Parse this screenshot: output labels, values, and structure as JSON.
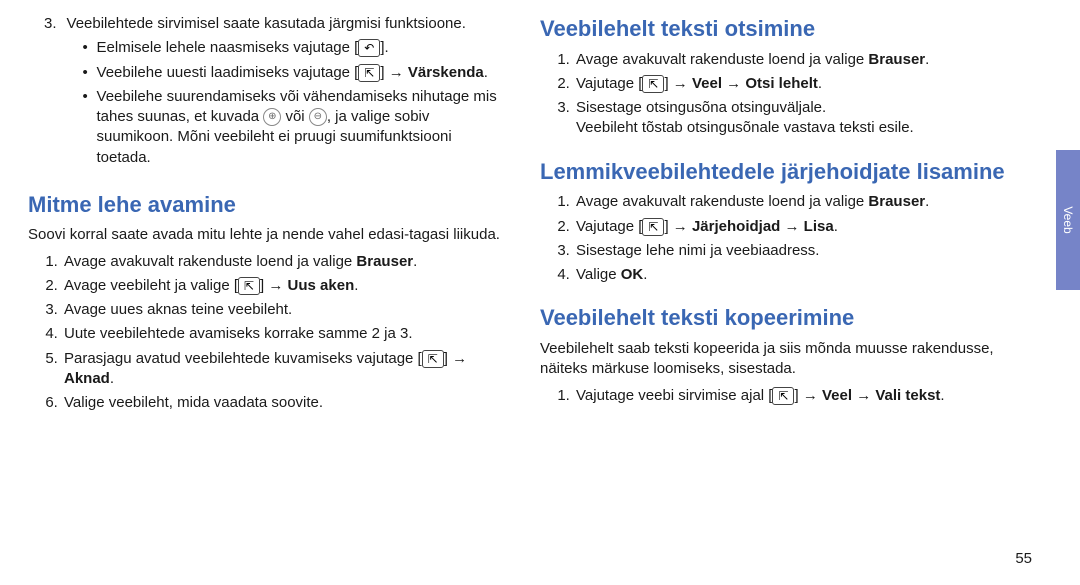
{
  "sideTab": "Veeb",
  "pageNumber": "55",
  "left": {
    "step3_intro": "Veebilehtede sirvimisel saate kasutada järgmisi funktsioone.",
    "step3_number": "3.",
    "b1_a": "Eelmisele lehele naasmiseks vajutage [",
    "b1_b": "].",
    "b2_a": "Veebilehe uuesti laadimiseks vajutage [",
    "b2_b": "] → ",
    "b2_strong": "Värskenda",
    "b2_c": ".",
    "b3_a": "Veebilehe suurendamiseks või vähendamiseks nihutage mis tahes suunas, et kuvada ",
    "b3_b": " või ",
    "b3_c": ", ja valige sobiv suumikoon. Mõni veebileht ei pruugi suumifunktsiooni toetada.",
    "h1": "Mitme lehe avamine",
    "p1": "Soovi korral saate avada mitu lehte ja nende vahel edasi-tagasi liikuda.",
    "s1_a": "Avage avakuvalt rakenduste loend ja valige ",
    "s1_strong": "Brauser",
    "s1_b": ".",
    "s2_a": "Avage veebileht ja valige [",
    "s2_b": "] → ",
    "s2_strong": "Uus aken",
    "s2_c": ".",
    "s3": "Avage uues aknas teine veebileht.",
    "s4": "Uute veebilehtede avamiseks korrake samme 2 ja 3.",
    "s5_a": "Parasjagu avatud veebilehtede kuvamiseks vajutage [",
    "s5_b": "] → ",
    "s5_strong": "Aknad",
    "s5_c": ".",
    "s6": "Valige veebileht, mida vaadata soovite."
  },
  "right": {
    "h2": "Veebilehelt teksti otsimine",
    "r1_a": "Avage avakuvalt rakenduste loend ja valige ",
    "r1_strong": "Brauser",
    "r1_b": ".",
    "r2_a": "Vajutage [",
    "r2_b": "] → ",
    "r2_strong1": "Veel",
    "r2_arrow": " → ",
    "r2_strong2": "Otsi lehelt",
    "r2_c": ".",
    "r3": "Sisestage otsingusõna otsinguväljale.",
    "r3b": "Veebileht tõstab otsingusõnale vastava teksti esile.",
    "h3": "Lemmikveebilehtedele järjehoidjate lisamine",
    "f1_a": "Avage avakuvalt rakenduste loend ja valige ",
    "f1_strong": "Brauser",
    "f1_b": ".",
    "f2_a": "Vajutage [",
    "f2_b": "] → ",
    "f2_strong1": "Järjehoidjad",
    "f2_arrow": " → ",
    "f2_strong2": "Lisa",
    "f2_c": ".",
    "f3": "Sisestage lehe nimi ja veebiaadress.",
    "f4_a": "Valige ",
    "f4_strong": "OK",
    "f4_b": ".",
    "h4": "Veebilehelt teksti kopeerimine",
    "cp1": "Veebilehelt saab teksti kopeerida ja siis mõnda muusse rakendusse, näiteks märkuse loomiseks, sisestada.",
    "c1_a": "Vajutage veebi sirvimise ajal [",
    "c1_b": "] → ",
    "c1_strong1": "Veel",
    "c1_arrow": " → ",
    "c1_strong2": "Vali tekst",
    "c1_c": "."
  }
}
